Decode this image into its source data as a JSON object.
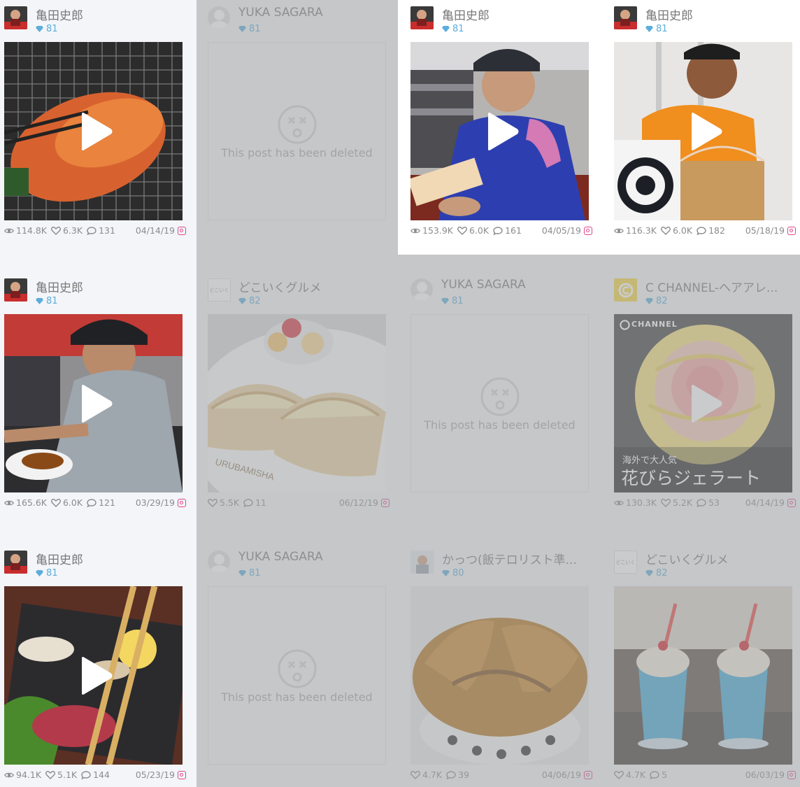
{
  "colors": {
    "accent": "#5aaedc",
    "instagram": "#e0468c",
    "overlay": "#9ea0a3"
  },
  "deleted_text": "This post has been deleted",
  "cards": [
    {
      "name": "亀田史郎",
      "score": "81",
      "views": "114.8K",
      "likes": "6.3K",
      "comments": "131",
      "date": "04/14/19",
      "icon": "instagram-icon"
    },
    {
      "name": "YUKA SAGARA",
      "score": "81"
    },
    {
      "name": "亀田史郎",
      "score": "81",
      "views": "153.9K",
      "likes": "6.0K",
      "comments": "161",
      "date": "04/05/19",
      "icon": "instagram-icon"
    },
    {
      "name": "亀田史郎",
      "score": "81",
      "views": "116.3K",
      "likes": "6.0K",
      "comments": "182",
      "date": "05/18/19",
      "icon": "instagram-icon"
    },
    {
      "name": "亀田史郎",
      "score": "81",
      "views": "165.6K",
      "likes": "6.0K",
      "comments": "121",
      "date": "03/29/19",
      "icon": "instagram-icon"
    },
    {
      "name": "どこいくグルメ",
      "score": "82",
      "likes": "5.5K",
      "comments": "11",
      "date": "06/12/19",
      "avatar_text": "どこいく",
      "photo_text": "URUBAMISHA",
      "icon": "instagram-icon"
    },
    {
      "name": "YUKA SAGARA",
      "score": "81"
    },
    {
      "name": "C CHANNEL-ヘアアレ...",
      "score": "82",
      "views": "130.3K",
      "likes": "5.2K",
      "comments": "53",
      "date": "04/14/19",
      "brand": "CHANNEL",
      "caption_small": "海外で大人気",
      "caption_big": "花びらジェラート",
      "icon": "instagram-icon"
    },
    {
      "name": "亀田史郎",
      "score": "81",
      "views": "94.1K",
      "likes": "5.1K",
      "comments": "144",
      "date": "05/23/19",
      "icon": "instagram-icon"
    },
    {
      "name": "YUKA SAGARA",
      "score": "81"
    },
    {
      "name": "かっつ(飯テロリスト準...",
      "score": "80",
      "likes": "4.7K",
      "comments": "39",
      "date": "04/06/19",
      "icon": "instagram-icon"
    },
    {
      "name": "どこいくグルメ",
      "score": "82",
      "likes": "4.7K",
      "comments": "5",
      "date": "06/03/19",
      "avatar_text": "どこいく",
      "icon": "instagram-icon"
    }
  ]
}
